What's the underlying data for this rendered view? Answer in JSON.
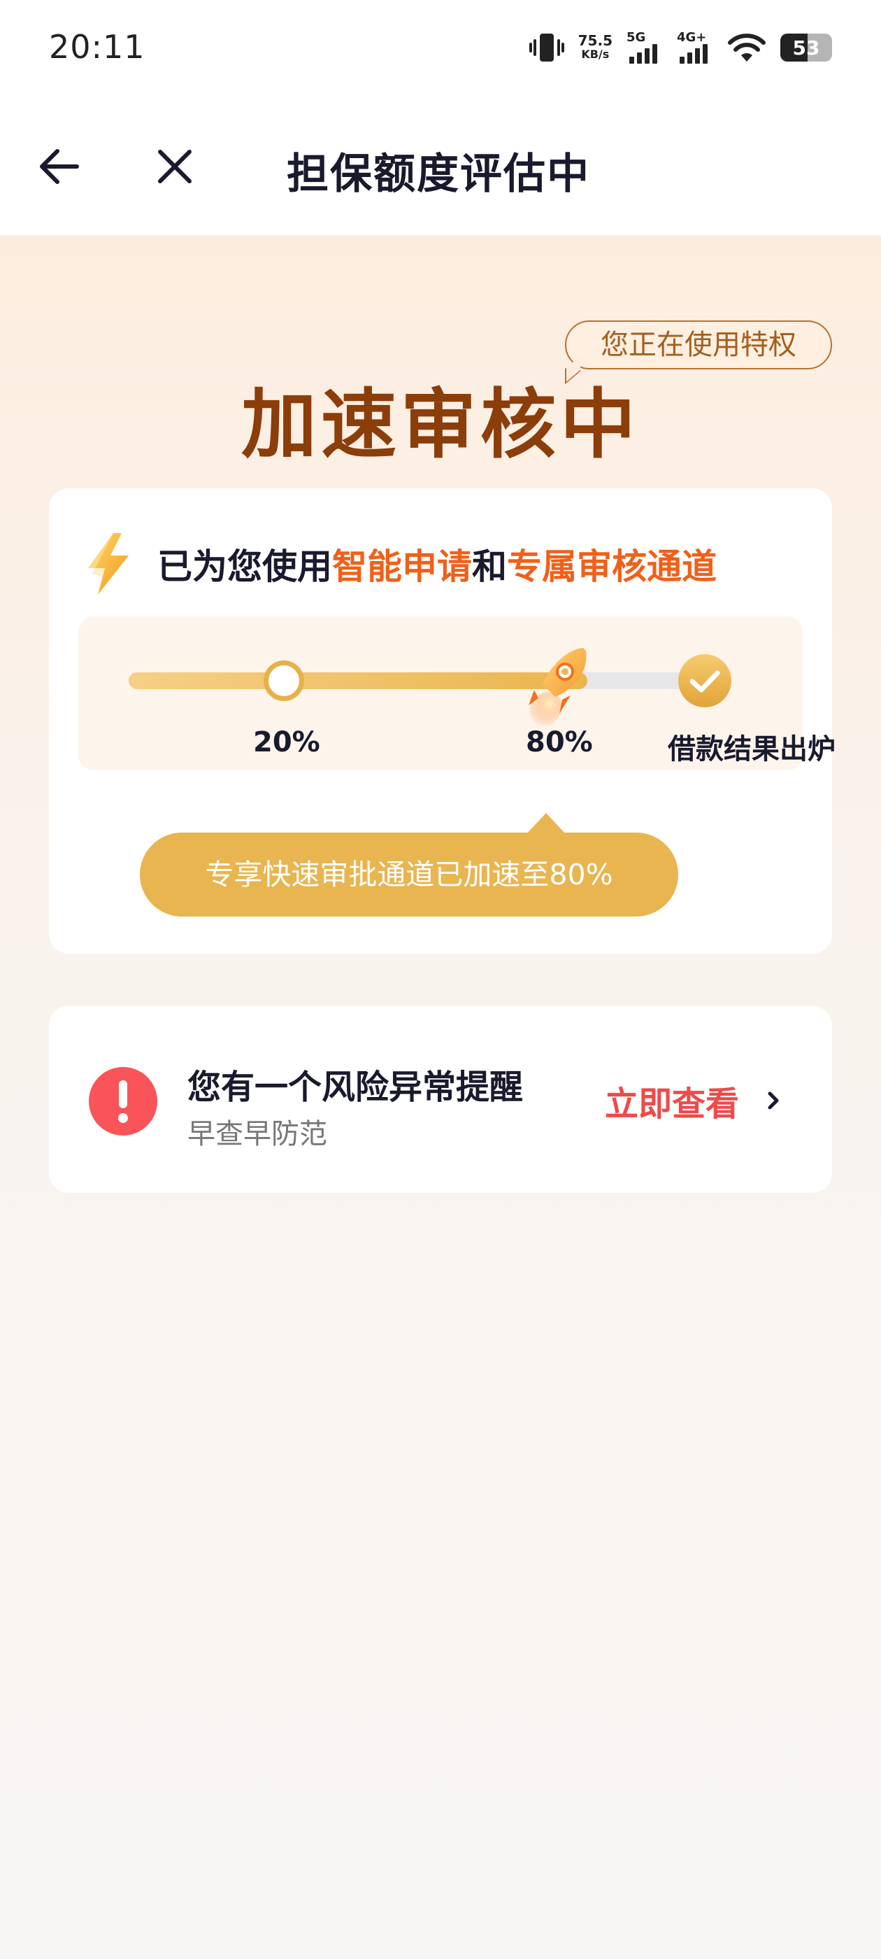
{
  "status_bar": {
    "time": "20:11",
    "net_speed_value": "75.5",
    "net_speed_unit": "KB/s",
    "sim1_label": "5G",
    "sim2_label": "4G+",
    "battery": "53",
    "icons": [
      "vibrate-icon",
      "signal-icon",
      "wifi-icon",
      "battery-icon"
    ]
  },
  "nav": {
    "title": "担保额度评估中",
    "icons": [
      "back-arrow-icon",
      "close-icon"
    ]
  },
  "hero": {
    "privilege_tag": "您正在使用特权",
    "title": "加速审核中"
  },
  "main_card": {
    "headline_prefix": "已为您使用",
    "headline_highlight_1": "智能申请",
    "headline_mid": "和",
    "headline_highlight_2": "专属审核通道",
    "highlight_color": "#f0601a",
    "progress": {
      "value": 0.8,
      "labels": [
        "20%",
        "80%",
        "借款结果出炉"
      ],
      "fill_color": "#eab54e"
    },
    "tip": "专享快速审批通道已加速至80%"
  },
  "risk_card": {
    "title": "您有一个风险异常提醒",
    "subtitle": "早查早防范",
    "link_label": "立即查看",
    "link_color": "#ef4a4a",
    "icons": [
      "alert-icon",
      "chevron-right-icon"
    ]
  }
}
